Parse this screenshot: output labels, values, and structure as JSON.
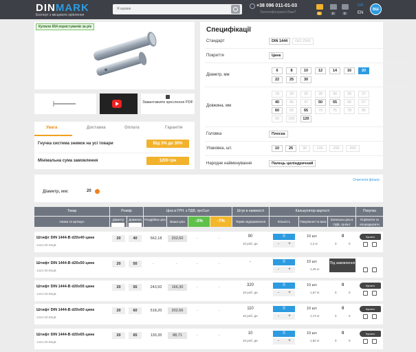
{
  "header": {
    "logo_a": "DIN",
    "logo_b": "MARK",
    "tagline": "Експерт з місцевого кріплення",
    "search_placeholder": "Я шукаю",
    "phone": "+38 096 011-01-03",
    "callback": "Зателефонувати Вам?",
    "counts": [
      "0",
      "0",
      "0"
    ],
    "lang_ua": "UA",
    "lang_en": "EN",
    "account": "ВШ",
    "accent": "#2d9be0",
    "icons": [
      "search-icon",
      "phone-icon",
      "wallet-icon",
      "compare-icon",
      "cart-icon"
    ]
  },
  "product": {
    "badge": "Купили 654 користувачів за рік",
    "download": "Завантажити креслення PDF",
    "tabs": [
      "Увага",
      "Доставка",
      "Оплата",
      "Гарантія"
    ],
    "promos": [
      {
        "label": "Гнучка система знижок на усі товари",
        "value": "Від 3% до 30%"
      },
      {
        "label": "Мінімальна сума замовлення",
        "value": "1200 грн"
      }
    ]
  },
  "specs": {
    "title": "Специфікації",
    "standard_label": "Стандарт",
    "standards": [
      "DIN 1444",
      "ISO 2341"
    ],
    "coating_label": "Покриття",
    "coating": "Цинк",
    "diameter_label": "Діаметр, мм",
    "diameters": [
      "6",
      "8",
      "10",
      "12",
      "14",
      "16",
      "20",
      "22",
      "25",
      "30"
    ],
    "diameter_selected": "20",
    "length_label": "Довжина, мм",
    "lengths": [
      "18",
      "20",
      "25",
      "28",
      "30",
      "35",
      "37",
      "40",
      "45",
      "47",
      "50",
      "55",
      "56",
      "57",
      "60",
      "62",
      "65",
      "70",
      "75",
      "78",
      "85",
      "90",
      "100",
      "120"
    ],
    "length_active": [
      "40",
      "50",
      "55",
      "60",
      "65",
      "120"
    ],
    "head_label": "Головка",
    "head": "Плоска",
    "pack_label": "Упаковка, шт.",
    "packs": [
      "10",
      "25",
      "30",
      "100",
      "200",
      "300"
    ],
    "pack_active": [
      "10",
      "25"
    ],
    "folk_label": "Народне найменування",
    "folk": "Палець циліндричний"
  },
  "filter": {
    "clear": "Очистити фільтр",
    "label": "Діаметр, мм:",
    "value": "20"
  },
  "table_head": {
    "goods": "Товар",
    "size": "Розмір",
    "price": "Ціна в ГРН. з ПДВ, грн/1шт",
    "stock": "Штук в наявності",
    "calc": "Калькулятор вартості",
    "buy": "Покупка",
    "name_sku": "Назва та артикул",
    "diam": "Діаметр",
    "len": "Довжина",
    "retail": "Роздрібна ціна",
    "yours": "Ваша ціна",
    "disc3": "-3%",
    "disc7": "-7%",
    "term": "Термін відправлення",
    "count": "Кількість",
    "packed": "Пакування та вага",
    "sum": "Загальна ціна в ПДВ, грн/шт",
    "compare": "Порівняти та впорядкувати"
  },
  "rows": [
    {
      "name": "Штифт DIN 1444-В d20х40 цинк",
      "sku": "1444-20-40цВ",
      "d": "20",
      "l": "40",
      "retail": "562,18",
      "yours": "202,60",
      "d3": "-",
      "d7": "-",
      "stock": "90",
      "days": "10 роб. дн.",
      "qty": "0",
      "minus": "-",
      "plus": "+",
      "pack": "10 шт.",
      "wt": "1,2 кг",
      "sum": "0",
      "sum2": "0",
      "sum3": "0",
      "buy": "Купити"
    },
    {
      "name": "Штифт DIN 1444-В d20х50 цинк",
      "sku": "1444-20-50цВ",
      "d": "20",
      "l": "50",
      "retail": "-",
      "yours": "-",
      "d3": "-",
      "d7": "-",
      "stock": "-",
      "days": "",
      "qty": "0",
      "minus": "-",
      "plus": "+",
      "pack": "10 шт.",
      "wt": "1,45 кг",
      "sum": "",
      "sum2": "",
      "sum3": "",
      "order": "Під замовлення",
      "buy": ""
    },
    {
      "name": "Штифт DIN 1444-В d20х55 цинк",
      "sku": "1444-20-55цВ",
      "d": "20",
      "l": "55",
      "retail": "243,92",
      "yours": "166,30",
      "d3": "-",
      "d7": "-",
      "stock": "320",
      "days": "10 роб. дн.",
      "qty": "0",
      "minus": "-",
      "plus": "+",
      "pack": "10 шт.",
      "wt": "1,57 кг",
      "sum": "0",
      "sum2": "0",
      "sum3": "0",
      "buy": "Купити"
    },
    {
      "name": "Штифт DIN 1444-В d20х60 цинк",
      "sku": "1444-20-60цВ",
      "d": "20",
      "l": "60",
      "retail": "518,20",
      "yours": "202,66",
      "d3": "-",
      "d7": "-",
      "stock": "110",
      "days": "10 роб. дн.",
      "qty": "0",
      "minus": "-",
      "plus": "+",
      "pack": "10 шт.",
      "wt": "1,72 кг",
      "sum": "0",
      "sum2": "0",
      "sum3": "0",
      "buy": "Купити"
    },
    {
      "name": "Штифт DIN 1444-В d20х65 цинк",
      "sku": "1444-20-65цВ",
      "d": "20",
      "l": "65",
      "retail": "130,35",
      "yours": "88,71",
      "d3": "-",
      "d7": "-",
      "stock": "10",
      "days": "10 роб. дн.",
      "qty": "0",
      "minus": "-",
      "plus": "+",
      "pack": "10 шт.",
      "wt": "1,82 кг",
      "sum": "0",
      "sum2": "0",
      "sum3": "0",
      "buy": "Купити"
    }
  ]
}
